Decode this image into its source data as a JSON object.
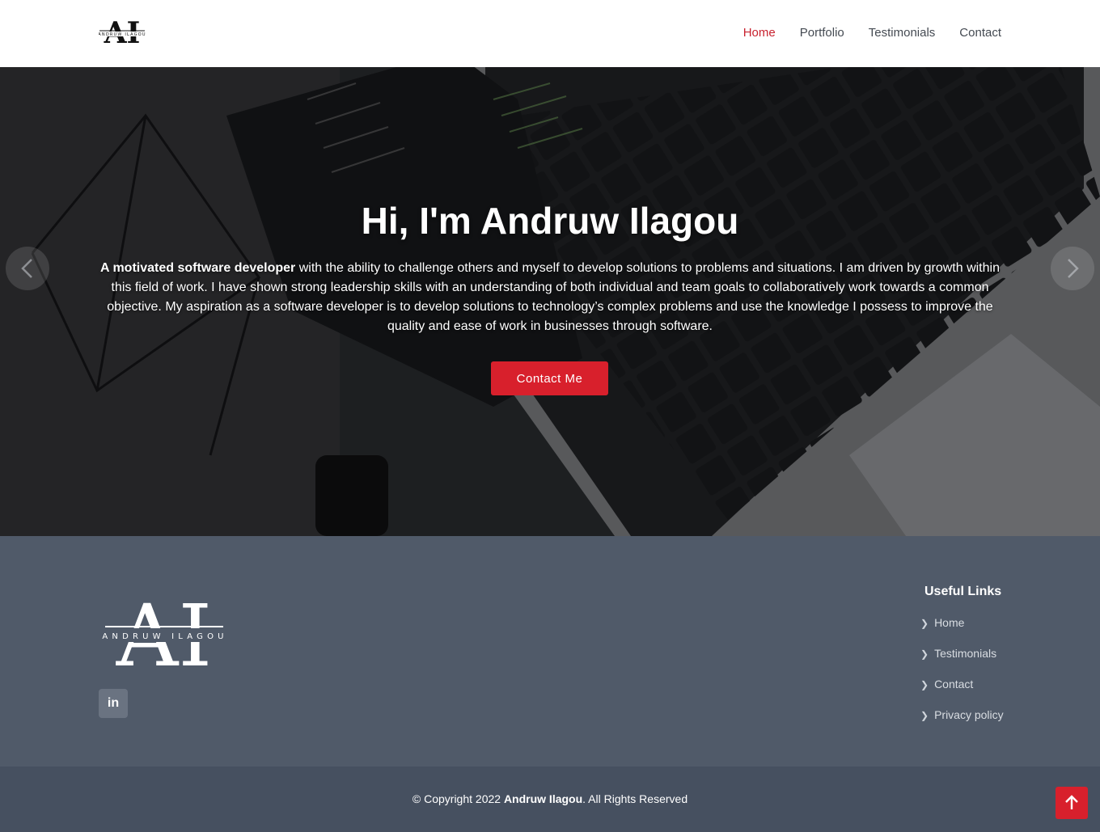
{
  "header": {
    "logo_alt": "AI",
    "nav": [
      {
        "label": "Home",
        "active": true
      },
      {
        "label": "Portfolio",
        "active": false
      },
      {
        "label": "Testimonials",
        "active": false
      },
      {
        "label": "Contact",
        "active": false
      }
    ]
  },
  "hero": {
    "title": "Hi, I'm Andruw Ilagou",
    "intro_bold": "A motivated software developer",
    "intro_rest": " with the ability to challenge others and myself to develop solutions to problems and situations. I am driven by growth within this field of work. I have shown strong leadership skills with an understanding of both individual and team goals to collaboratively work towards a common objective. My aspiration as a software developer is to develop solutions to technology’s complex problems and use the knowledge I possess to improve the quality and ease of work in businesses through software.",
    "cta_label": "Contact Me",
    "prev_icon": "chevron-left-icon",
    "next_icon": "chevron-right-icon"
  },
  "footer": {
    "logo_letters": "AI",
    "logo_name": "ANDRUW ILAGOU",
    "social_label": "in",
    "links_title": "Useful Links",
    "links": [
      "Home",
      "Testimonials",
      "Contact",
      "Privacy policy"
    ]
  },
  "bottom": {
    "copy_prefix": "© Copyright 2022 ",
    "copy_name": "Andruw Ilagou",
    "copy_suffix": ". All Rights Reserved",
    "to_top_icon": "arrow-up-icon"
  },
  "colors": {
    "accent": "#d8202c",
    "footer": "#505a69",
    "bottom": "#465060"
  }
}
